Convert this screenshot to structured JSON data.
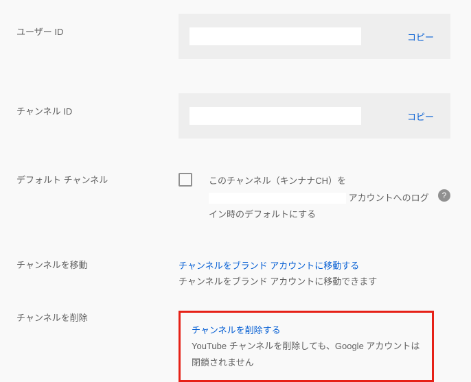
{
  "rows": {
    "user_id": {
      "label": "ユーザー ID",
      "copy": "コピー"
    },
    "channel_id": {
      "label": "チャンネル ID",
      "copy": "コピー"
    },
    "default_channel": {
      "label": "デフォルト チャンネル",
      "text_part1": "このチャンネル（キンナナCH）を",
      "text_part2": "アカウントへのログイン時のデフォルトにする"
    },
    "move_channel": {
      "label": "チャンネルを移動",
      "link": "チャンネルをブランド アカウントに移動する",
      "desc": "チャンネルをブランド アカウントに移動できます"
    },
    "delete_channel": {
      "label": "チャンネルを削除",
      "link": "チャンネルを削除する",
      "desc": "YouTube チャンネルを削除しても、Google アカウントは閉鎖されません"
    }
  },
  "help_glyph": "?"
}
